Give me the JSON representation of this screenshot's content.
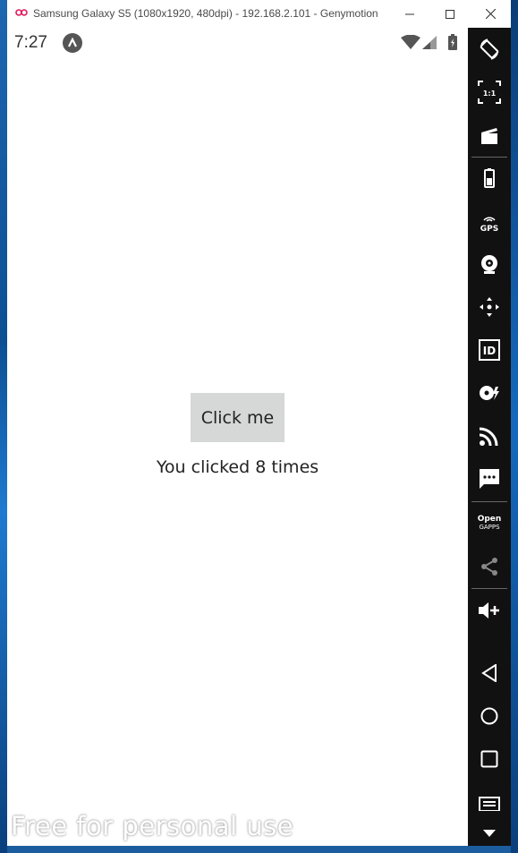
{
  "window": {
    "title": "Samsung Galaxy S5 (1080x1920, 480dpi) - 192.168.2.101 - Genymotion",
    "controls": {
      "minimize": "minimize-icon",
      "maximize": "maximize-icon",
      "close": "close-icon"
    }
  },
  "statusbar": {
    "time": "7:27",
    "notification_icon": "arrow-up-circle-icon",
    "icons": [
      "wifi-icon",
      "signal-icon",
      "battery-icon"
    ]
  },
  "app": {
    "button_label": "Click me",
    "click_message": "You clicked 8 times"
  },
  "watermark": "Free for personal use",
  "toolbar": {
    "items": [
      {
        "icon": "rotate-icon"
      },
      {
        "icon": "pixel-perfect-icon",
        "label": "1:1"
      },
      {
        "icon": "capture-icon"
      },
      {
        "icon": "battery-icon"
      },
      {
        "icon": "gps-icon",
        "label": "GPS"
      },
      {
        "icon": "webcam-icon"
      },
      {
        "icon": "remote-control-icon"
      },
      {
        "icon": "identifiers-icon",
        "label": "ID"
      },
      {
        "icon": "disk-io-icon"
      },
      {
        "icon": "network-icon"
      },
      {
        "icon": "sms-icon"
      },
      {
        "icon": "open-gapps-icon",
        "label_top": "Open",
        "label_bottom": "GAPPS"
      },
      {
        "icon": "share-icon"
      },
      {
        "icon": "volume-up-icon"
      },
      {
        "icon": "back-icon"
      },
      {
        "icon": "home-icon"
      },
      {
        "icon": "recent-apps-icon"
      },
      {
        "icon": "menu-icon"
      },
      {
        "icon": "scroll-down-icon"
      }
    ]
  },
  "colors": {
    "toolbar_bg": "#111111",
    "button_bg": "#d6d7d7",
    "desktop": "#1b5d9e"
  }
}
